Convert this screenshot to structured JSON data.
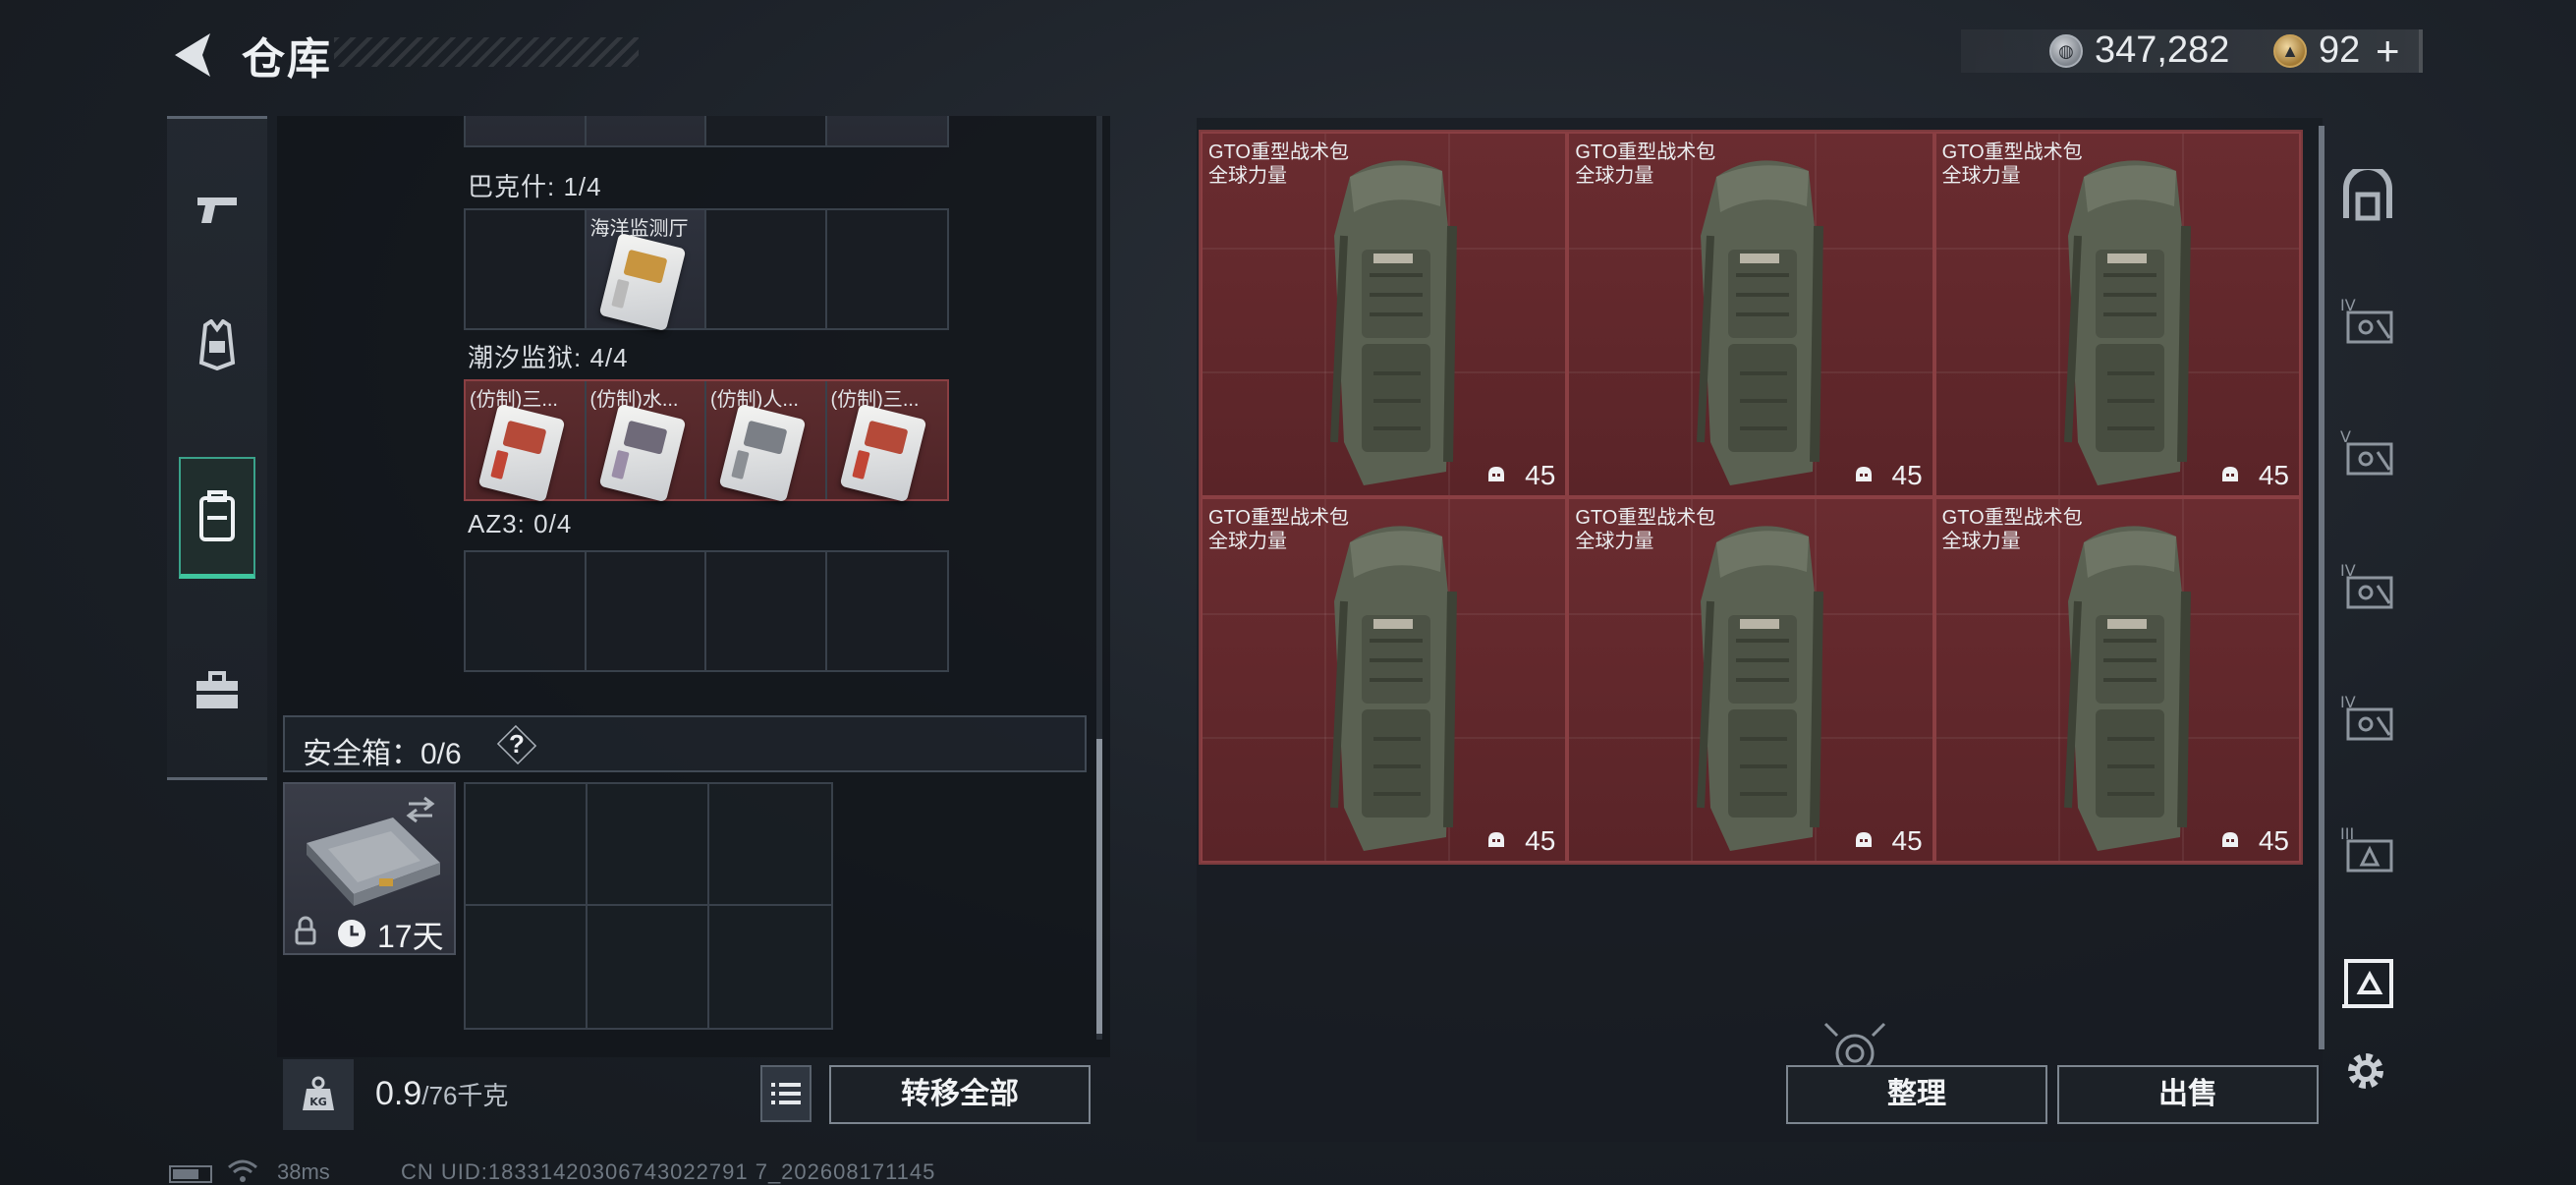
{
  "header": {
    "title": "仓库",
    "silver_amount": "347,282",
    "gold_amount": "92",
    "gold_plus": "+"
  },
  "left_nav": {
    "items": [
      {
        "name": "weapons",
        "icon": "pistol-icon"
      },
      {
        "name": "armor",
        "icon": "vest-icon"
      },
      {
        "name": "backpack",
        "icon": "backpack-icon",
        "active": true
      },
      {
        "name": "supplies",
        "icon": "toolbox-icon"
      }
    ]
  },
  "inventory": {
    "rows": [
      {
        "label": "巴克什: 1/4",
        "cells": [
          {
            "filled": false
          },
          {
            "filled": true,
            "label": "海洋监测厅",
            "style": "grey",
            "chip_color": "#c8953f",
            "stripe_color": "#b9b9b9"
          },
          {
            "filled": false
          },
          {
            "filled": false
          }
        ]
      },
      {
        "label": "潮汐监狱: 4/4",
        "cells": [
          {
            "filled": true,
            "label": "(仿制)三...",
            "style": "red",
            "chip_color": "#b54a39",
            "stripe_color": "#c14535"
          },
          {
            "filled": true,
            "label": "(仿制)水...",
            "style": "red",
            "chip_color": "#6f6a79",
            "stripe_color": "#9a8da7"
          },
          {
            "filled": true,
            "label": "(仿制)人...",
            "style": "red",
            "chip_color": "#7b7f86",
            "stripe_color": "#8b8f94"
          },
          {
            "filled": true,
            "label": "(仿制)三...",
            "style": "red",
            "chip_color": "#b54a39",
            "stripe_color": "#c14535"
          }
        ]
      },
      {
        "label": "AZ3: 0/4",
        "cells": [
          {
            "filled": false
          },
          {
            "filled": false
          },
          {
            "filled": false
          },
          {
            "filled": false
          }
        ]
      }
    ],
    "safe_box": {
      "label": "安全箱：0/6",
      "help": "?",
      "days": "17天"
    },
    "weight": {
      "current": "0.9",
      "max": "/76千克",
      "icon_text": "KG"
    },
    "transfer_all": "转移全部"
  },
  "stash": {
    "items": [
      {
        "name": "GTO重型战术包",
        "brand": "全球力量",
        "durability": "45"
      },
      {
        "name": "GTO重型战术包",
        "brand": "全球力量",
        "durability": "45"
      },
      {
        "name": "GTO重型战术包",
        "brand": "全球力量",
        "durability": "45"
      },
      {
        "name": "GTO重型战术包",
        "brand": "全球力量",
        "durability": "45"
      },
      {
        "name": "GTO重型战术包",
        "brand": "全球力量",
        "durability": "45"
      },
      {
        "name": "GTO重型战术包",
        "brand": "全球力量",
        "durability": "45"
      }
    ],
    "sort_label": "整理",
    "sell_label": "出售"
  },
  "right_rail": {
    "items": [
      {
        "name": "all-tier-icon"
      },
      {
        "name": "tier-4-icon",
        "tier": "IV"
      },
      {
        "name": "tier-5-icon",
        "tier": "V"
      },
      {
        "name": "tier-4-icon",
        "tier": "IV"
      },
      {
        "name": "tier-4-icon",
        "tier": "IV"
      },
      {
        "name": "tier-3-icon",
        "tier": "III"
      },
      {
        "name": "selected-tier-icon"
      }
    ]
  },
  "status": {
    "ping": "38ms",
    "uid": "CN UID:18331420306743022791 7_202608171145"
  },
  "colors": {
    "accent_green": "#3fc59e",
    "stash_red": "#6a2c30"
  }
}
